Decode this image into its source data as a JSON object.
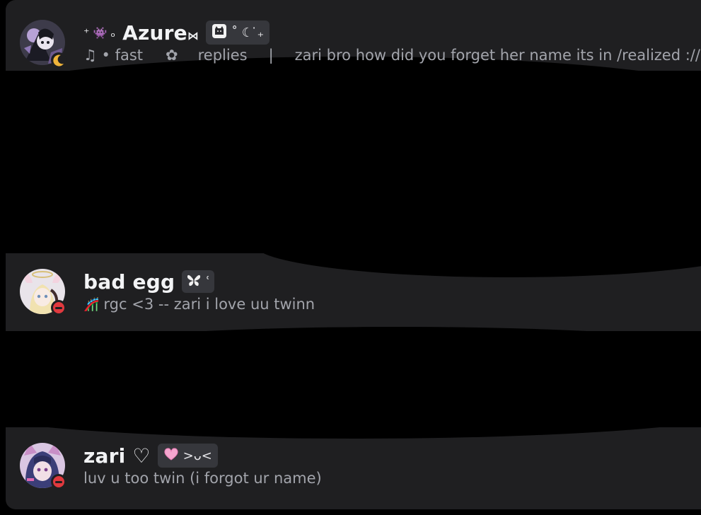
{
  "members": [
    {
      "prefix": "⁺ 👾 ₒ",
      "name": "Azure",
      "name_suffix": "⋈",
      "tag": "˚ ☾ ̇₊",
      "status": [
        "♫ • fast",
        "✿",
        "replies",
        "|",
        "zari bro how did you forget her name its in /realized ://"
      ]
    },
    {
      "name": "bad egg",
      "tag": "ʿ",
      "status_icon": "🎢",
      "status": "rgc <3 -- zari i love uu twinn",
      "presence": "dnd"
    },
    {
      "name": "zari ♡",
      "tag": ">ᴗ<",
      "status": "luv u too twin (i forgot ur name)",
      "presence": "dnd"
    }
  ],
  "colors": {
    "panel": "#1f1f21",
    "name": "#f2f3f5",
    "status_text": "#a2a4ab",
    "tag_bg": "#36373c",
    "dnd": "#e0393e"
  },
  "icons": {
    "avatar_1": "gothic-character-avatar",
    "avatar_2": "angel-halo-anime-avatar",
    "avatar_3": "cat-ear-anime-avatar",
    "tag_1": "cat-icon",
    "tag_2": "butterfly-icon",
    "tag_3": "pink-heart-icon"
  }
}
